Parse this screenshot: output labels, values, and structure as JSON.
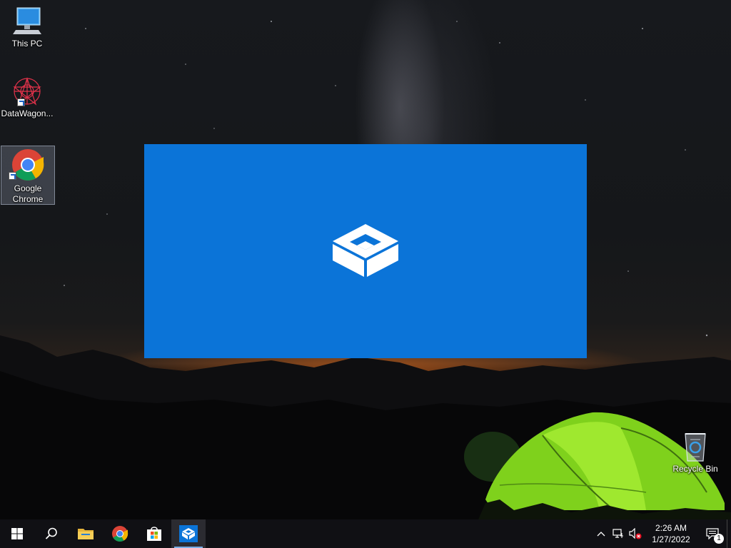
{
  "desktop": {
    "icons": [
      {
        "label": "This PC",
        "icon": "computer-icon"
      },
      {
        "label": "DataWagon...",
        "icon": "datawagon-icon"
      },
      {
        "label": "Google Chrome",
        "icon": "chrome-icon"
      },
      {
        "label": "Recycle Bin",
        "icon": "recycle-bin-icon"
      }
    ]
  },
  "splash": {
    "app_icon": "sandbox-box-icon",
    "background_color": "#0b74d8"
  },
  "taskbar": {
    "items": [
      {
        "name": "Start",
        "icon": "windows-logo-icon"
      },
      {
        "name": "Search",
        "icon": "search-icon"
      },
      {
        "name": "File Explorer",
        "icon": "folder-icon",
        "running": false
      },
      {
        "name": "Google Chrome",
        "icon": "chrome-icon",
        "running": false
      },
      {
        "name": "Microsoft Store",
        "icon": "store-icon",
        "running": false
      },
      {
        "name": "Windows Sandbox",
        "icon": "sandbox-box-icon",
        "running": true,
        "active": true
      }
    ],
    "tray": {
      "overflow_icon": "chevron-up-icon",
      "network_icon": "network-icon",
      "volume_icon": "volume-muted-icon",
      "time": "2:26 AM",
      "date": "1/27/2022",
      "notifications_count": "1"
    }
  }
}
